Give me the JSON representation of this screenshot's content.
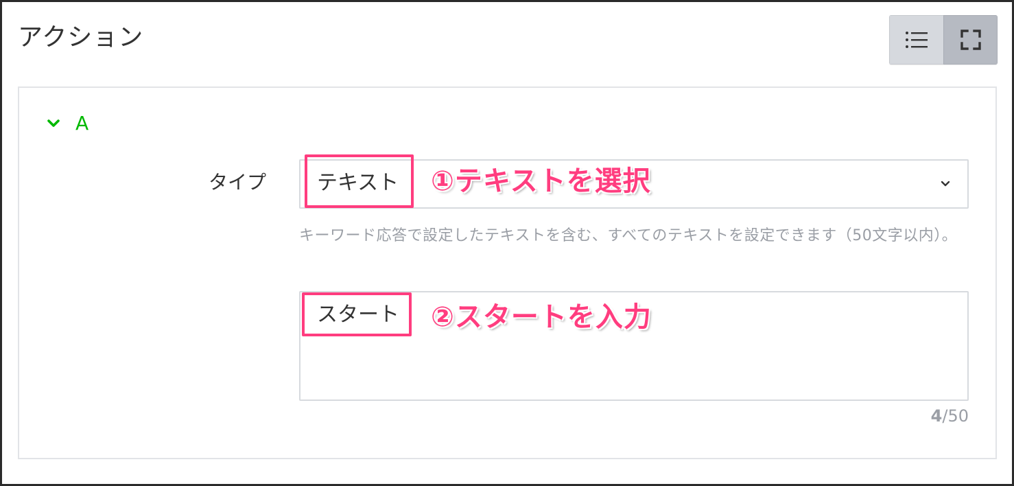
{
  "header": {
    "title": "アクション",
    "view_toggle": {
      "list_icon": "list-icon",
      "fullscreen_icon": "fullscreen-icon"
    }
  },
  "section": {
    "label": "A",
    "chevron_icon": "chevron-down-icon",
    "accent_color": "#00b900"
  },
  "type_field": {
    "label": "タイプ",
    "selected_value": "テキスト",
    "caret_icon": "chevron-down-icon",
    "hint": "キーワード応答で設定したテキストを含む、すべてのテキストを設定できます（50文字以内）。"
  },
  "text_field": {
    "value": "スタート",
    "counter_current": "4",
    "counter_max": "/50"
  },
  "annotations": {
    "step1": "①テキストを選択",
    "step2": "②スタートを入力",
    "highlight_color": "#ff3d7f"
  }
}
